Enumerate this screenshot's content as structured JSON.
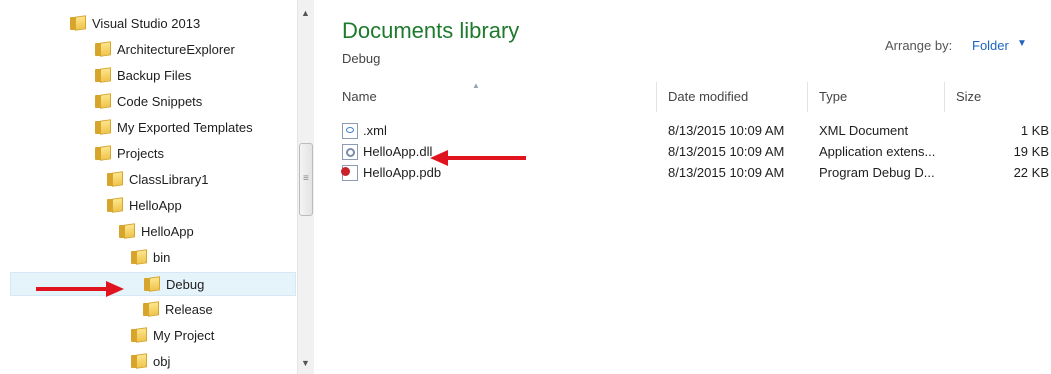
{
  "nav": {
    "items": [
      {
        "label": "Visual Studio 2013",
        "indent": 0,
        "selected": false
      },
      {
        "label": "ArchitectureExplorer",
        "indent": 1,
        "selected": false
      },
      {
        "label": "Backup Files",
        "indent": 1,
        "selected": false
      },
      {
        "label": "Code Snippets",
        "indent": 1,
        "selected": false
      },
      {
        "label": "My Exported Templates",
        "indent": 1,
        "selected": false
      },
      {
        "label": "Projects",
        "indent": 1,
        "selected": false
      },
      {
        "label": "ClassLibrary1",
        "indent": 2,
        "selected": false
      },
      {
        "label": "HelloApp",
        "indent": 2,
        "selected": false
      },
      {
        "label": "HelloApp",
        "indent": 3,
        "selected": false
      },
      {
        "label": "bin",
        "indent": 4,
        "selected": false
      },
      {
        "label": "Debug",
        "indent": 5,
        "selected": true
      },
      {
        "label": "Release",
        "indent": 5,
        "selected": false
      },
      {
        "label": "My Project",
        "indent": 4,
        "selected": false
      },
      {
        "label": "obj",
        "indent": 4,
        "selected": false
      }
    ]
  },
  "content": {
    "title": "Documents library",
    "subtitle": "Debug",
    "arrange_label": "Arrange by:",
    "arrange_value": "Folder",
    "columns": {
      "name": "Name",
      "date": "Date modified",
      "type": "Type",
      "size": "Size"
    },
    "files": [
      {
        "name": ".xml",
        "date": "8/13/2015 10:09 AM",
        "type": "XML Document",
        "size": "1 KB",
        "icon": "xml-file-icon"
      },
      {
        "name": "HelloApp.dll",
        "date": "8/13/2015 10:09 AM",
        "type": "Application extens...",
        "size": "19 KB",
        "icon": "dll-file-icon"
      },
      {
        "name": "HelloApp.pdb",
        "date": "8/13/2015 10:09 AM",
        "type": "Program Debug D...",
        "size": "22 KB",
        "icon": "pdb-file-icon"
      }
    ]
  },
  "colors": {
    "title_green": "#1e7a2d",
    "link_blue": "#1f64c2",
    "annotation_red": "#e0141e",
    "selection": "#e5f3fb"
  }
}
